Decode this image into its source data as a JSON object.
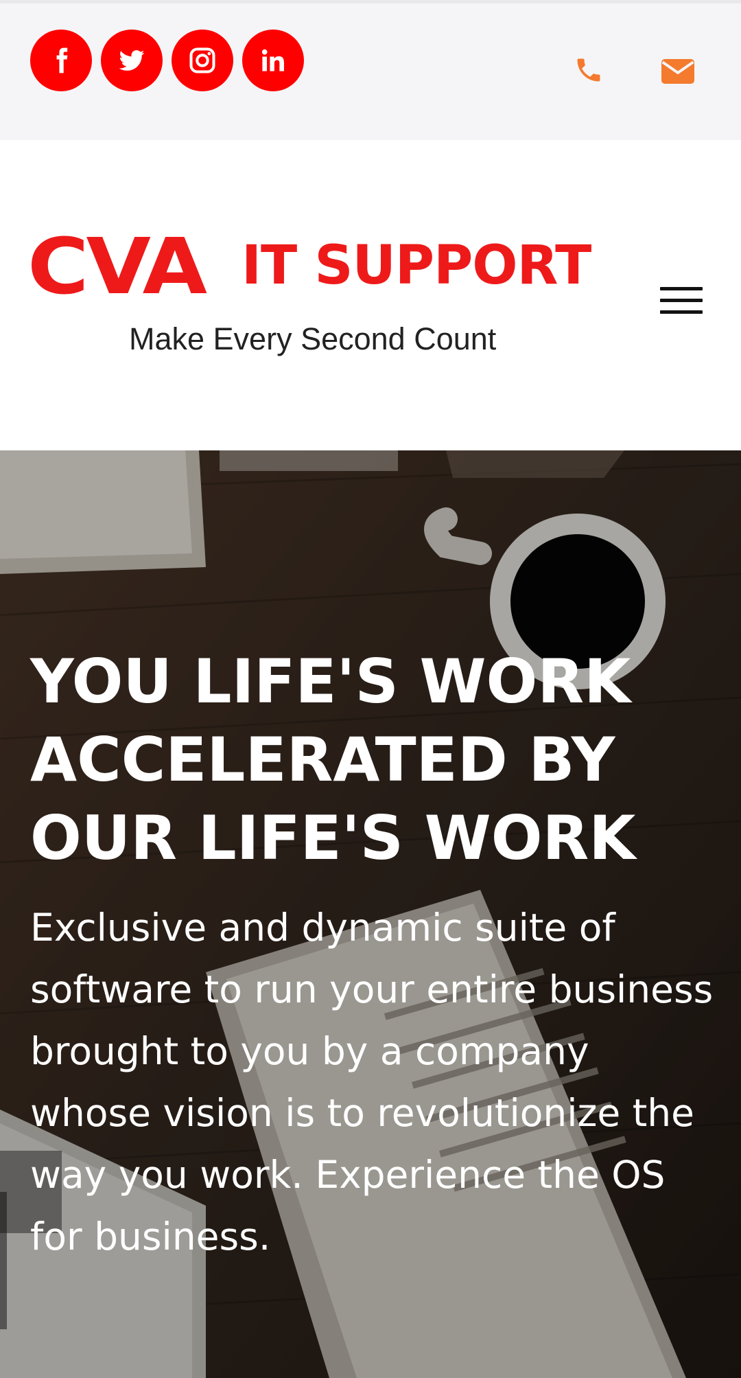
{
  "colors": {
    "brand_red": "#ff0000",
    "logo_red": "#ee1a1a",
    "contact_orange": "#f47a2e",
    "topbar_bg": "#f5f5f7",
    "hero_text": "#ffffff"
  },
  "topbar": {
    "social": [
      {
        "name": "facebook",
        "icon": "facebook-icon"
      },
      {
        "name": "twitter",
        "icon": "twitter-icon"
      },
      {
        "name": "instagram",
        "icon": "instagram-icon"
      },
      {
        "name": "linkedin",
        "icon": "linkedin-icon"
      }
    ],
    "contact": [
      {
        "name": "phone",
        "icon": "phone-icon"
      },
      {
        "name": "email",
        "icon": "envelope-icon"
      }
    ]
  },
  "header": {
    "logo": {
      "brand": "CVA",
      "sub": "IT SUPPORT",
      "tagline": "Make Every Second Count"
    },
    "menu_icon": "hamburger-menu-icon"
  },
  "hero": {
    "title": "YOU LIFE'S WORK ACCELERATED BY OUR LIFE'S WORK",
    "text": "Exclusive and dynamic suite of software to run your entire business brought to you by a company whose vision is to revolutionize the way you work. Experience the OS for business."
  }
}
